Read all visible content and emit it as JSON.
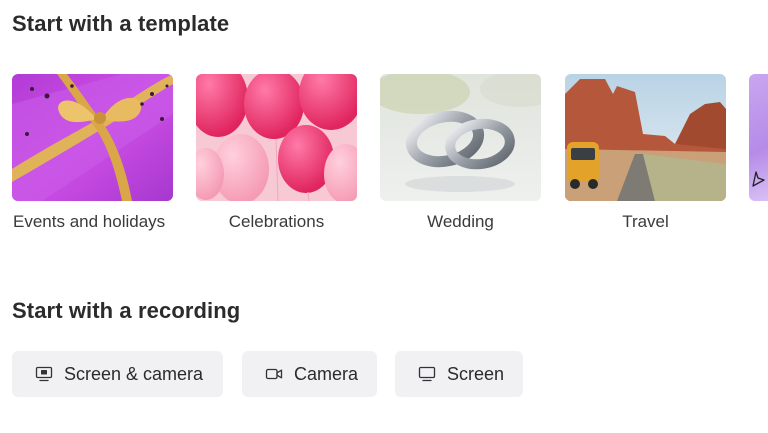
{
  "templates": {
    "title": "Start with a template",
    "tiles": [
      {
        "label": "Events and holidays"
      },
      {
        "label": "Celebrations"
      },
      {
        "label": "Wedding"
      },
      {
        "label": "Travel"
      }
    ]
  },
  "recording": {
    "title": "Start with a recording",
    "buttons": [
      {
        "label": "Screen & camera",
        "icon": "screen-camera-icon"
      },
      {
        "label": "Camera",
        "icon": "camera-icon"
      },
      {
        "label": "Screen",
        "icon": "screen-icon"
      }
    ]
  },
  "colors": {
    "button_bg": "#f1f1f4",
    "text": "#2b2b2b"
  }
}
